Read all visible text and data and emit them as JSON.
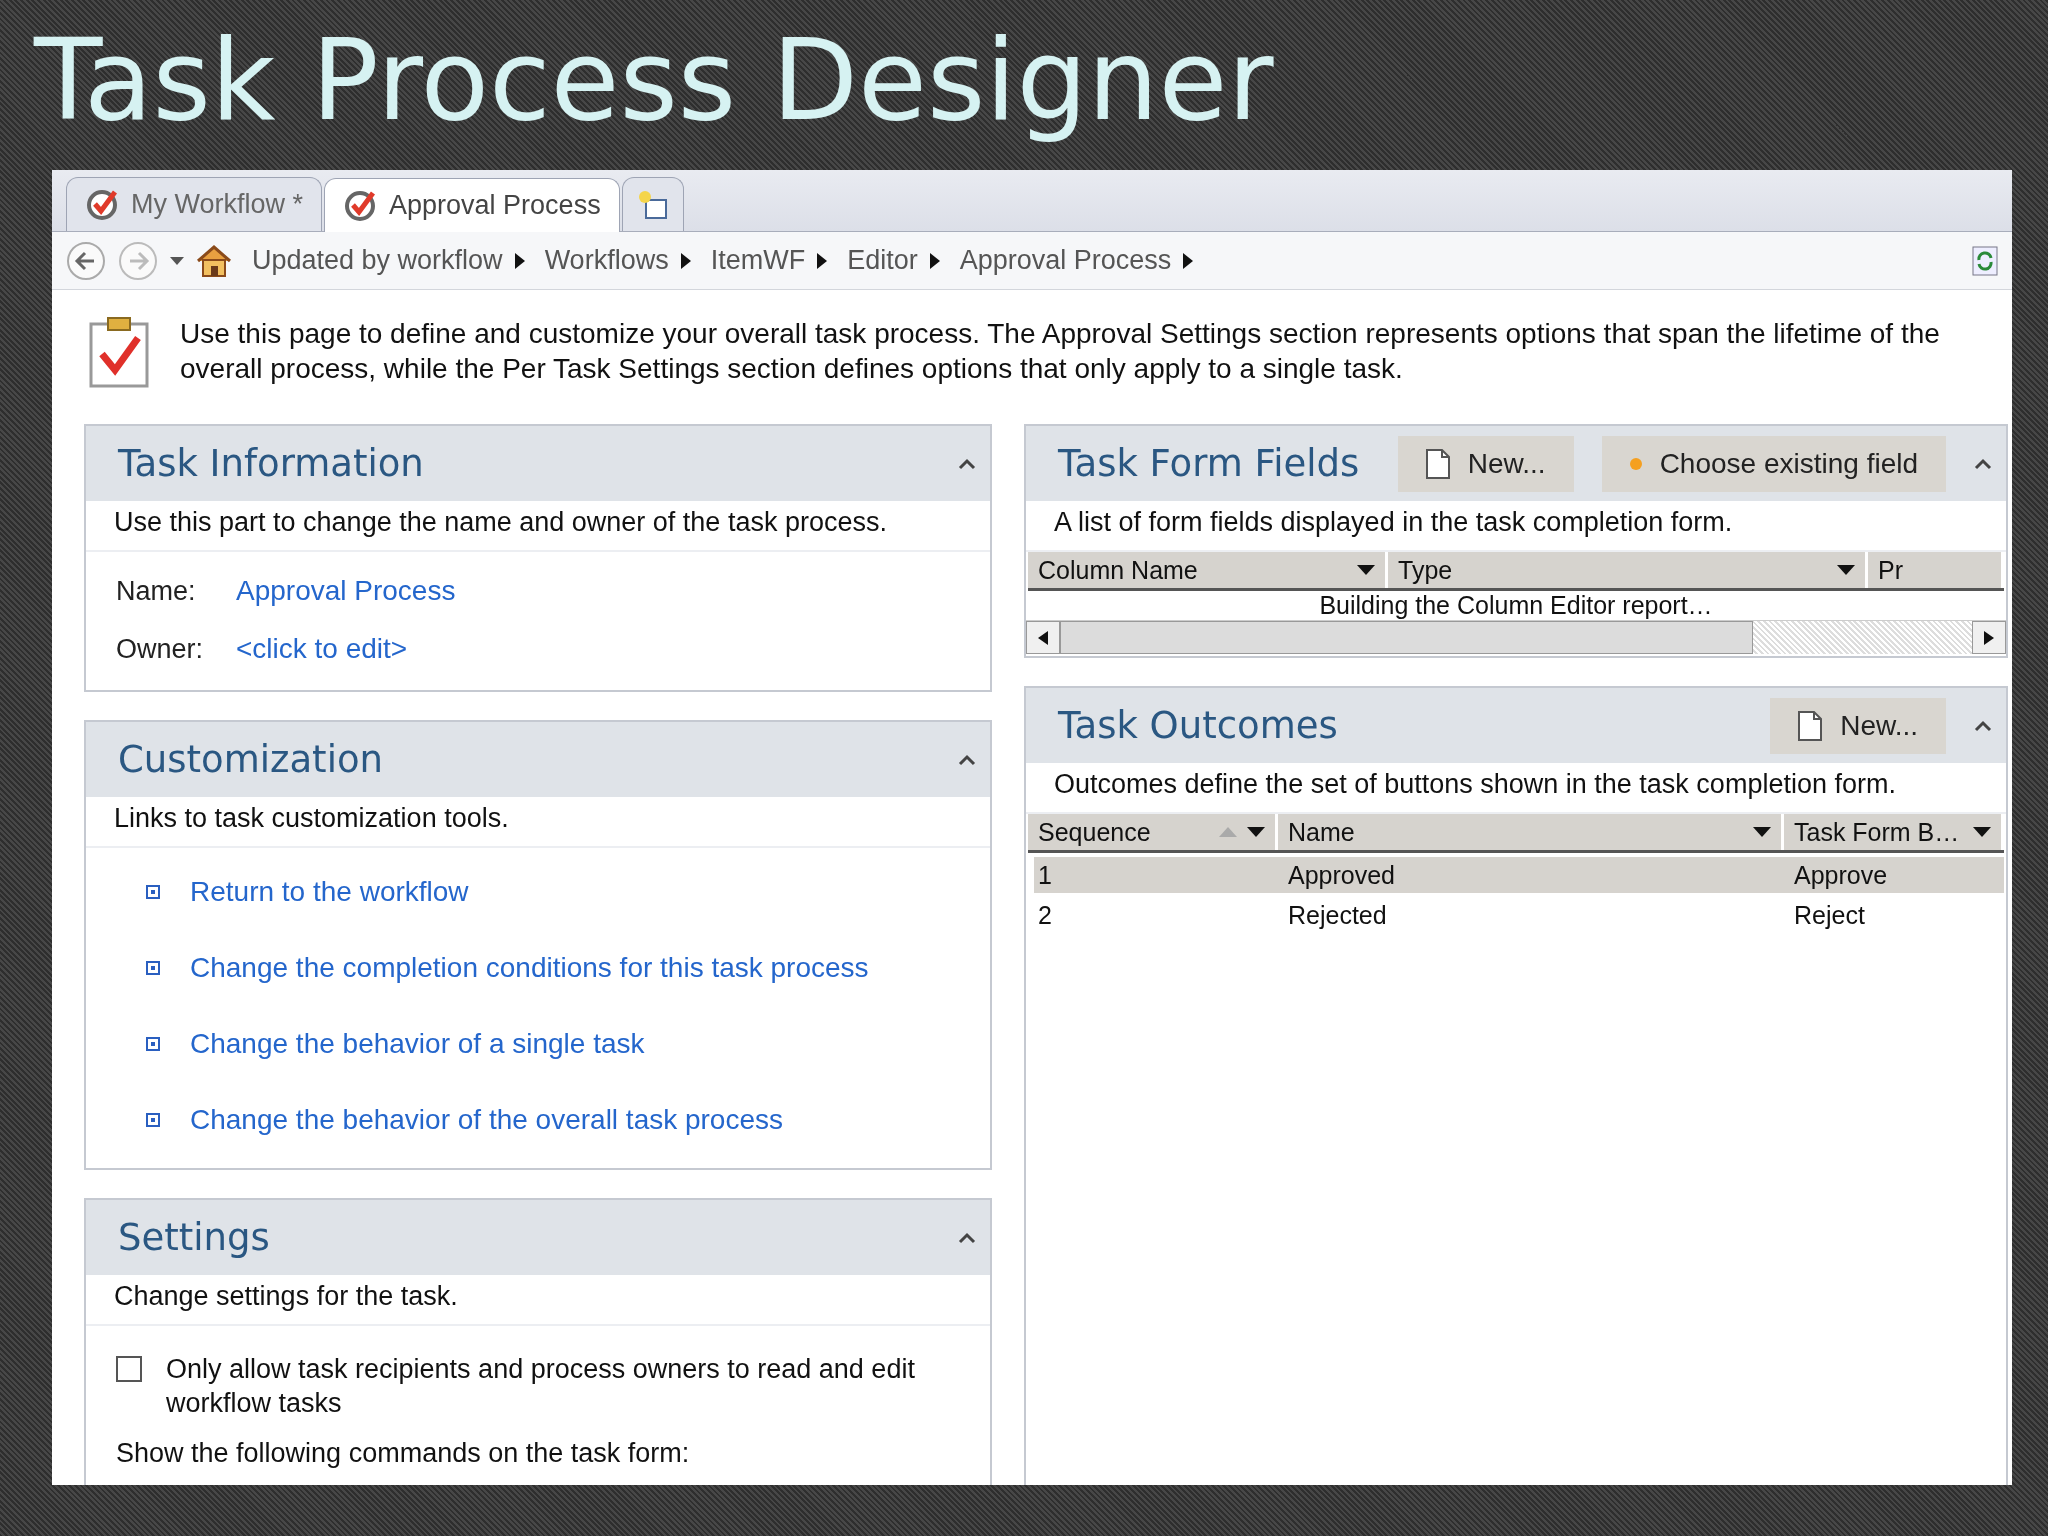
{
  "slide_title": "Task Process Designer",
  "tabs": [
    {
      "label": "My Workflow *",
      "selected": false
    },
    {
      "label": "Approval Process",
      "selected": true
    }
  ],
  "breadcrumb": [
    "Updated by workflow",
    "Workflows",
    "ItemWF",
    "Editor",
    "Approval Process"
  ],
  "intro": "Use this page to define and customize your overall task process. The Approval Settings section represents options that span the lifetime of the overall process, while the Per Task Settings section defines options that only apply to a single task.",
  "task_information": {
    "title": "Task Information",
    "description": "Use this part to change the name and owner of the task process.",
    "fields": [
      {
        "label": "Name:",
        "value": "Approval Process"
      },
      {
        "label": "Owner:",
        "value": "<click to edit>"
      }
    ]
  },
  "customization": {
    "title": "Customization",
    "description": "Links to task customization tools.",
    "links": [
      "Return to the workflow",
      "Change the completion conditions for this task process",
      "Change the behavior of a single task",
      "Change the behavior of the overall task process"
    ]
  },
  "settings": {
    "title": "Settings",
    "description": "Change settings for the task.",
    "options": [
      {
        "label": "Only allow task recipients and process owners to read and edit workflow tasks",
        "checked": false
      }
    ],
    "subheading": "Show the following commands on the task form:"
  },
  "task_form_fields": {
    "title": "Task Form Fields",
    "new_button": "New...",
    "choose_button": "Choose existing field",
    "description": "A list of form fields displayed in the task completion form.",
    "columns": [
      "Column Name",
      "Type",
      "Pr"
    ],
    "status": "Building the Column Editor report…"
  },
  "task_outcomes": {
    "title": "Task Outcomes",
    "new_button": "New...",
    "description": "Outcomes define the set of buttons shown in the task completion form.",
    "columns": [
      "Sequence",
      "Name",
      "Task Form B…"
    ],
    "rows": [
      {
        "cells": [
          "1",
          "Approved",
          "Approve"
        ],
        "selected": true
      },
      {
        "cells": [
          "2",
          "Rejected",
          "Reject"
        ],
        "selected": false
      }
    ]
  }
}
